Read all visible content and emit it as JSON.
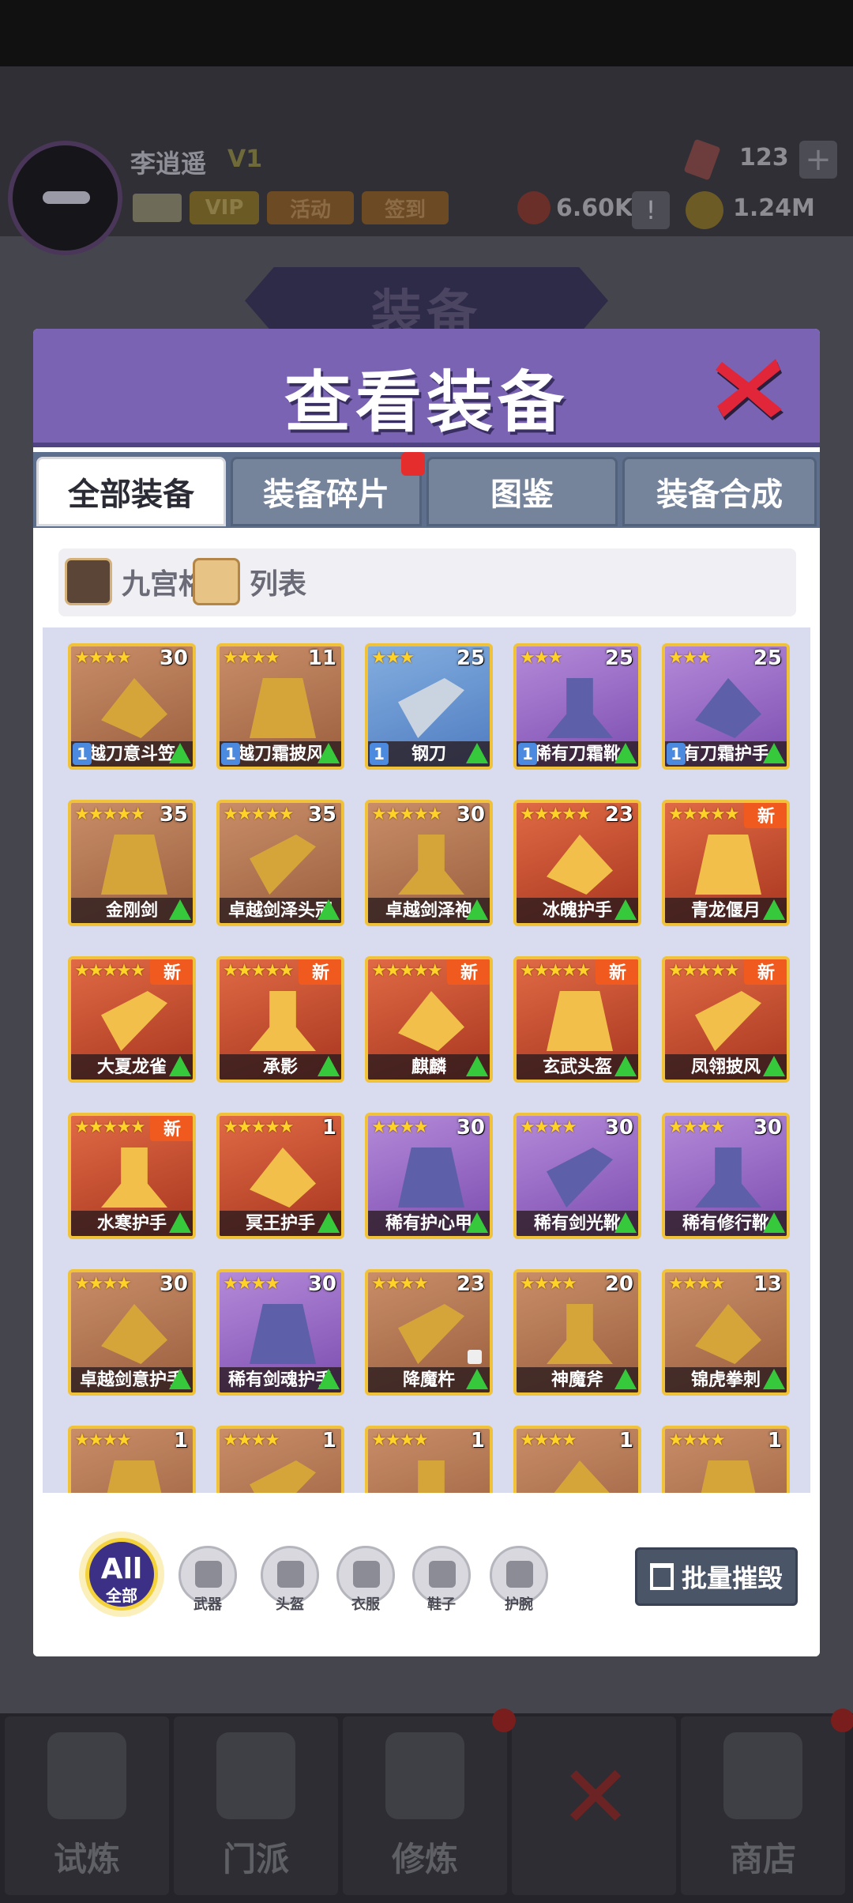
{
  "player": {
    "name": "李逍遥",
    "vip_badge": "V1",
    "vip_label": "VIP",
    "activity_label": "活动",
    "signin_label": "签到"
  },
  "resources": {
    "gems": "123",
    "power": "6.60K",
    "coins": "1.24M"
  },
  "background_banner": "装备",
  "modal": {
    "title": "查看装备",
    "tabs": [
      {
        "label": "全部装备",
        "active": true
      },
      {
        "label": "装备碎片",
        "active": false,
        "badge": true
      },
      {
        "label": "图鉴",
        "active": false
      },
      {
        "label": "装备合成",
        "active": false
      }
    ],
    "view_modes": [
      {
        "label": "九宫格",
        "icon": "grid-icon"
      },
      {
        "label": "列表",
        "icon": "list-icon"
      }
    ],
    "items": [
      {
        "name": "越刀意斗笠",
        "stars": 4,
        "count": "30",
        "rarity": "brown",
        "level": "1",
        "upgradable": true
      },
      {
        "name": "越刀霜披风",
        "stars": 4,
        "count": "11",
        "rarity": "brown",
        "level": "1",
        "upgradable": true
      },
      {
        "name": "钢刀",
        "stars": 3,
        "count": "25",
        "rarity": "blue",
        "level": "1",
        "upgradable": true
      },
      {
        "name": "稀有刀霜靴",
        "stars": 3,
        "count": "25",
        "rarity": "purple",
        "level": "1",
        "upgradable": true
      },
      {
        "name": "有刀霜护手",
        "stars": 3,
        "count": "25",
        "rarity": "purple",
        "level": "1",
        "upgradable": true
      },
      {
        "name": "金刚剑",
        "stars": 5,
        "count": "35",
        "rarity": "brown",
        "upgradable": true
      },
      {
        "name": "卓越剑泽头冠",
        "stars": 5,
        "count": "35",
        "rarity": "brown",
        "upgradable": true
      },
      {
        "name": "卓越剑泽袍",
        "stars": 5,
        "count": "30",
        "rarity": "brown",
        "upgradable": true
      },
      {
        "name": "冰魄护手",
        "stars": 5,
        "count": "23",
        "rarity": "red",
        "upgradable": true
      },
      {
        "name": "青龙偃月",
        "stars": 5,
        "count": "",
        "rarity": "red",
        "new": "新",
        "upgradable": true
      },
      {
        "name": "大夏龙雀",
        "stars": 5,
        "count": "",
        "rarity": "red",
        "new": "新",
        "upgradable": true
      },
      {
        "name": "承影",
        "stars": 5,
        "count": "",
        "rarity": "red",
        "new": "新",
        "upgradable": true
      },
      {
        "name": "麒麟",
        "stars": 5,
        "count": "",
        "rarity": "red",
        "new": "新",
        "upgradable": true
      },
      {
        "name": "玄武头盔",
        "stars": 5,
        "count": "",
        "rarity": "red",
        "new": "新",
        "upgradable": true
      },
      {
        "name": "凤翎披风",
        "stars": 5,
        "count": "",
        "rarity": "red",
        "new": "新",
        "upgradable": true
      },
      {
        "name": "水寒护手",
        "stars": 5,
        "count": "",
        "rarity": "red",
        "new": "新",
        "upgradable": true
      },
      {
        "name": "冥王护手",
        "stars": 5,
        "count": "1",
        "rarity": "red",
        "upgradable": true
      },
      {
        "name": "稀有护心甲",
        "stars": 4,
        "count": "30",
        "rarity": "purple",
        "upgradable": true
      },
      {
        "name": "稀有剑光靴",
        "stars": 4,
        "count": "30",
        "rarity": "purple",
        "upgradable": true
      },
      {
        "name": "稀有修行靴",
        "stars": 4,
        "count": "30",
        "rarity": "purple",
        "upgradable": true
      },
      {
        "name": "卓越剑意护手",
        "stars": 4,
        "count": "30",
        "rarity": "brown",
        "upgradable": true
      },
      {
        "name": "稀有剑魂护手",
        "stars": 4,
        "count": "30",
        "rarity": "purple",
        "upgradable": true
      },
      {
        "name": "降魔杵",
        "stars": 4,
        "count": "23",
        "rarity": "brown",
        "locked": true,
        "upgradable": true
      },
      {
        "name": "神魔斧",
        "stars": 4,
        "count": "20",
        "rarity": "brown",
        "upgradable": true
      },
      {
        "name": "锦虎拳刺",
        "stars": 4,
        "count": "13",
        "rarity": "brown",
        "upgradable": true
      },
      {
        "name": "",
        "stars": 4,
        "count": "1",
        "rarity": "brown"
      },
      {
        "name": "",
        "stars": 4,
        "count": "1",
        "rarity": "brown"
      },
      {
        "name": "",
        "stars": 4,
        "count": "1",
        "rarity": "brown"
      },
      {
        "name": "",
        "stars": 4,
        "count": "1",
        "rarity": "brown"
      },
      {
        "name": "",
        "stars": 4,
        "count": "1",
        "rarity": "brown"
      }
    ],
    "filters": {
      "all_text": "All",
      "all_label": "全部",
      "categories": [
        {
          "label": "武器",
          "icon": "crossed-swords-icon"
        },
        {
          "label": "头盔",
          "icon": "helmet-icon"
        },
        {
          "label": "衣服",
          "icon": "clothes-icon"
        },
        {
          "label": "鞋子",
          "icon": "boot-icon"
        },
        {
          "label": "护腕",
          "icon": "bracer-icon"
        }
      ]
    },
    "bulk_destroy_label": "批量摧毁"
  },
  "bottom_nav": [
    {
      "label": "试炼"
    },
    {
      "label": "门派"
    },
    {
      "label": "修炼"
    },
    {
      "label": ""
    },
    {
      "label": "商店"
    }
  ],
  "colors": {
    "header_purple": "#7a63b3",
    "tab_blue": "#5d6f8c",
    "gold_border": "#f0c23a",
    "new_badge": "#f05a1e",
    "upgrade_arrow": "#36c93c"
  }
}
